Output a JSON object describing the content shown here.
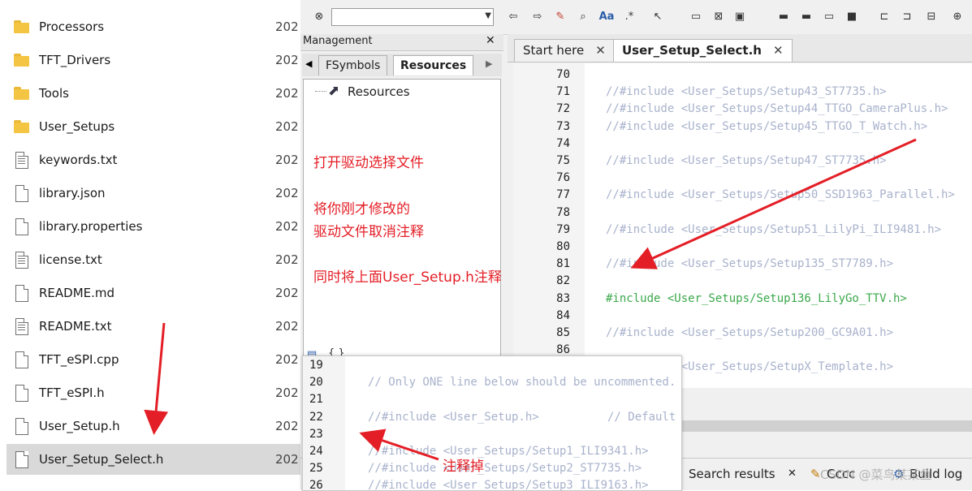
{
  "explorer": {
    "items": [
      {
        "name": "Processors",
        "type": "folder",
        "date": "202"
      },
      {
        "name": "TFT_Drivers",
        "type": "folder",
        "date": "202"
      },
      {
        "name": "Tools",
        "type": "folder",
        "date": "202"
      },
      {
        "name": "User_Setups",
        "type": "folder",
        "date": "202"
      },
      {
        "name": "keywords.txt",
        "type": "text",
        "date": "202"
      },
      {
        "name": "library.json",
        "type": "file",
        "date": "202"
      },
      {
        "name": "library.properties",
        "type": "file",
        "date": "202"
      },
      {
        "name": "license.txt",
        "type": "text",
        "date": "202"
      },
      {
        "name": "README.md",
        "type": "file",
        "date": "202"
      },
      {
        "name": "README.txt",
        "type": "text",
        "date": "202"
      },
      {
        "name": "TFT_eSPI.cpp",
        "type": "file",
        "date": "202"
      },
      {
        "name": "TFT_eSPI.h",
        "type": "file",
        "date": "202"
      },
      {
        "name": "User_Setup.h",
        "type": "file",
        "date": "202"
      },
      {
        "name": "User_Setup_Select.h",
        "type": "file",
        "date": "202",
        "selected": true
      }
    ]
  },
  "management": {
    "title": "Management",
    "close": "✕",
    "tabs": [
      "FSymbols",
      "Resources"
    ],
    "active_tab": "Resources",
    "tree_root": "Resources",
    "bottom_label": "{ }"
  },
  "annotations": {
    "note1": "打开驱动选择文件",
    "note2": "将你刚才修改的",
    "note3": "驱动文件取消注释",
    "note4": "同时将上面User_Setup.h注释",
    "note5": "注释掉"
  },
  "editor": {
    "tabs": [
      {
        "label": "Start here",
        "close": "✕"
      },
      {
        "label": "User_Setup_Select.h",
        "close": "✕",
        "active": true
      }
    ],
    "lines": [
      {
        "n": "70",
        "code": ""
      },
      {
        "n": "71",
        "code": "//#include <User_Setups/Setup43_ST7735.h>"
      },
      {
        "n": "72",
        "code": "//#include <User_Setups/Setup44_TTGO_CameraPlus.h>"
      },
      {
        "n": "73",
        "code": "//#include <User_Setups/Setup45_TTGO_T_Watch.h>"
      },
      {
        "n": "74",
        "code": ""
      },
      {
        "n": "75",
        "code": "//#include <User_Setups/Setup47_ST7735.h>"
      },
      {
        "n": "76",
        "code": ""
      },
      {
        "n": "77",
        "code": "//#include <User_Setups/Setup50_SSD1963_Parallel.h>"
      },
      {
        "n": "78",
        "code": ""
      },
      {
        "n": "79",
        "code": "//#include <User_Setups/Setup51_LilyPi_ILI9481.h>"
      },
      {
        "n": "80",
        "code": ""
      },
      {
        "n": "81",
        "code": "//#include <User_Setups/Setup135_ST7789.h>"
      },
      {
        "n": "82",
        "code": ""
      },
      {
        "n": "83",
        "code": "#include <User_Setups/Setup136_LilyGo_TTV.h>",
        "active": true
      },
      {
        "n": "84",
        "code": ""
      },
      {
        "n": "85",
        "code": "//#include <User_Setups/Setup200_GC9A01.h>"
      },
      {
        "n": "86",
        "code": ""
      },
      {
        "n": "",
        "code": "//#include <User_Setups/SetupX_Template.h>"
      }
    ]
  },
  "overlay": {
    "lines": [
      {
        "n": "19",
        "code": ""
      },
      {
        "n": "20",
        "code": "// Only ONE line below should be uncommented."
      },
      {
        "n": "21",
        "code": ""
      },
      {
        "n": "22",
        "code": "//#include <User_Setup.h>          // Default setup"
      },
      {
        "n": "23",
        "code": ""
      },
      {
        "n": "24",
        "code": "//#include <User_Setups/Setup1_ILI9341.h>"
      },
      {
        "n": "25",
        "code": "//#include <User_Setups/Setup2_ST7735.h>"
      },
      {
        "n": "26",
        "code": "//#include <User_Setups/Setup3_ILI9163.h>"
      }
    ]
  },
  "bottom_tabs": {
    "search_results": "Search results",
    "close": "✕",
    "cccc": "Cccc",
    "build_log": "Build log",
    "watermark": "CSDN @菜鸟某某鱼"
  },
  "colors": {
    "annotation_red": "#e41e26",
    "active_include_green": "#3aa84a",
    "comment_gray": "#a8b2cc"
  }
}
